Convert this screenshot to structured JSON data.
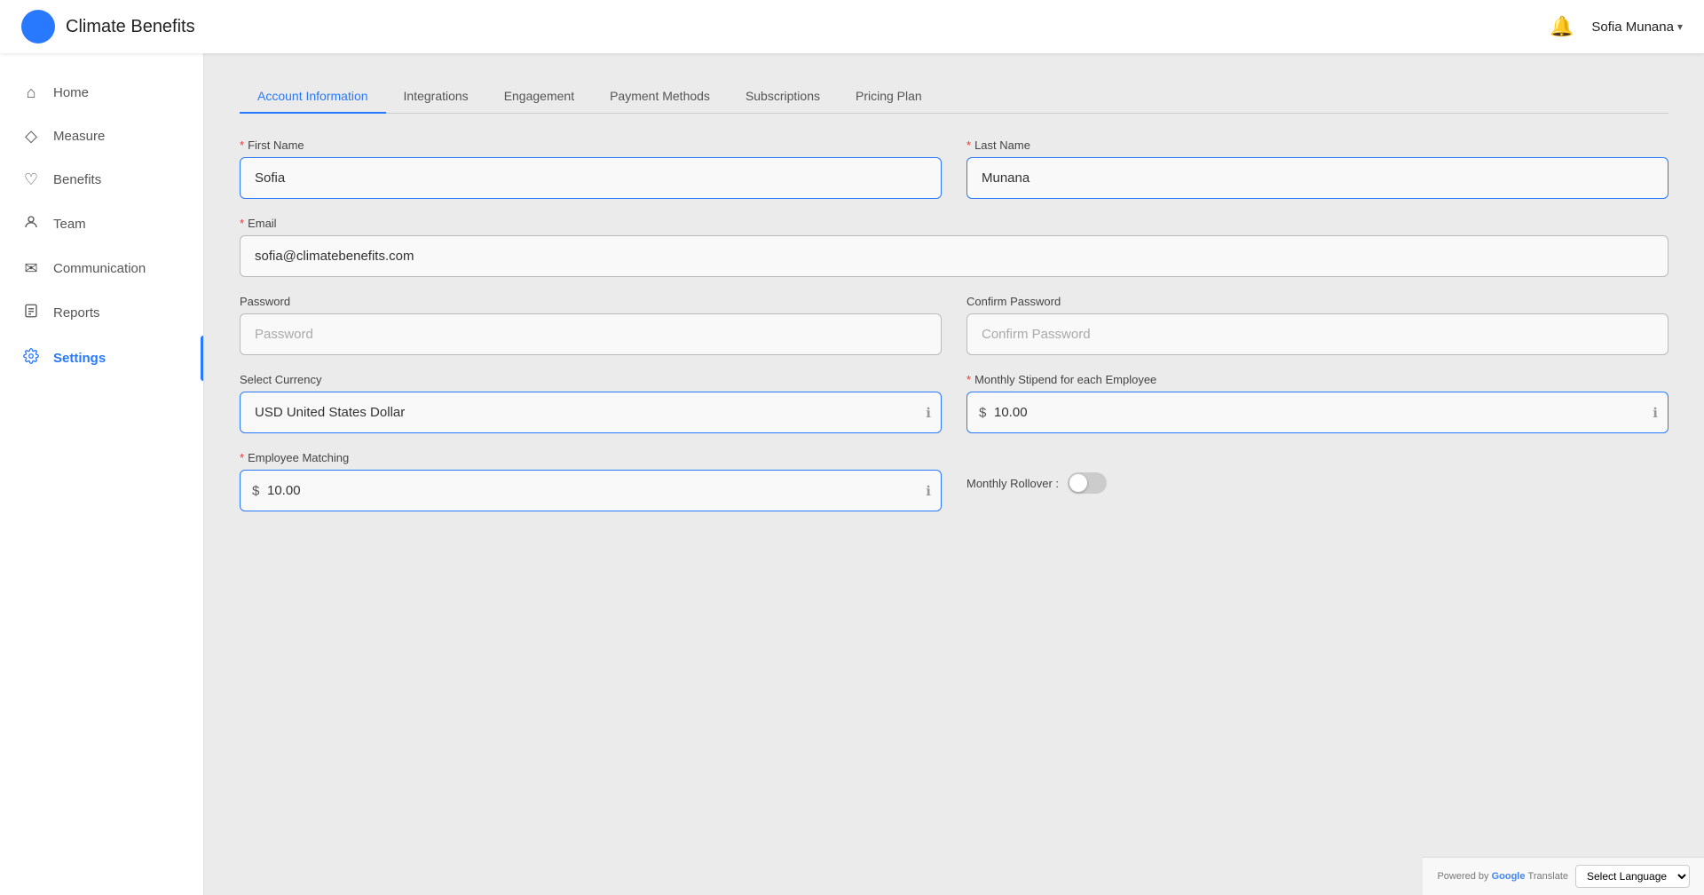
{
  "app": {
    "title": "Climate Benefits",
    "logo_color": "#2979ff"
  },
  "nav": {
    "bell_label": "notifications",
    "user_name": "Sofia Munana",
    "chevron": "▾"
  },
  "sidebar": {
    "items": [
      {
        "id": "home",
        "label": "Home",
        "icon": "⌂",
        "active": false
      },
      {
        "id": "measure",
        "label": "Measure",
        "icon": "◇",
        "active": false
      },
      {
        "id": "benefits",
        "label": "Benefits",
        "icon": "♡",
        "active": false
      },
      {
        "id": "team",
        "label": "Team",
        "icon": "👤",
        "active": false
      },
      {
        "id": "communication",
        "label": "Communication",
        "icon": "✉",
        "active": false
      },
      {
        "id": "reports",
        "label": "Reports",
        "icon": "📋",
        "active": false
      },
      {
        "id": "settings",
        "label": "Settings",
        "icon": "⚙",
        "active": true
      }
    ]
  },
  "tabs": [
    {
      "id": "account-information",
      "label": "Account Information",
      "active": true
    },
    {
      "id": "integrations",
      "label": "Integrations",
      "active": false
    },
    {
      "id": "engagement",
      "label": "Engagement",
      "active": false
    },
    {
      "id": "payment-methods",
      "label": "Payment Methods",
      "active": false
    },
    {
      "id": "subscriptions",
      "label": "Subscriptions",
      "active": false
    },
    {
      "id": "pricing-plan",
      "label": "Pricing Plan",
      "active": false
    }
  ],
  "form": {
    "first_name_label": "First Name",
    "first_name_value": "Sofia",
    "last_name_label": "Last Name",
    "last_name_value": "Munana",
    "email_label": "Email",
    "email_value": "sofia@climatebenefits.com",
    "password_label": "Password",
    "password_placeholder": "Password",
    "confirm_password_label": "Confirm Password",
    "confirm_password_placeholder": "Confirm Password",
    "select_currency_label": "Select Currency",
    "select_currency_value": "USD United States Dollar",
    "monthly_stipend_label": "Monthly Stipend for each Employee",
    "monthly_stipend_value": "10.00",
    "currency_symbol": "$",
    "employee_matching_label": "Employee Matching",
    "employee_matching_value": "10.00",
    "monthly_rollover_label": "Monthly Rollover :"
  },
  "translate": {
    "powered_by": "Powered by",
    "google": "Google",
    "translate": "Translate",
    "select_language": "Select Language"
  }
}
